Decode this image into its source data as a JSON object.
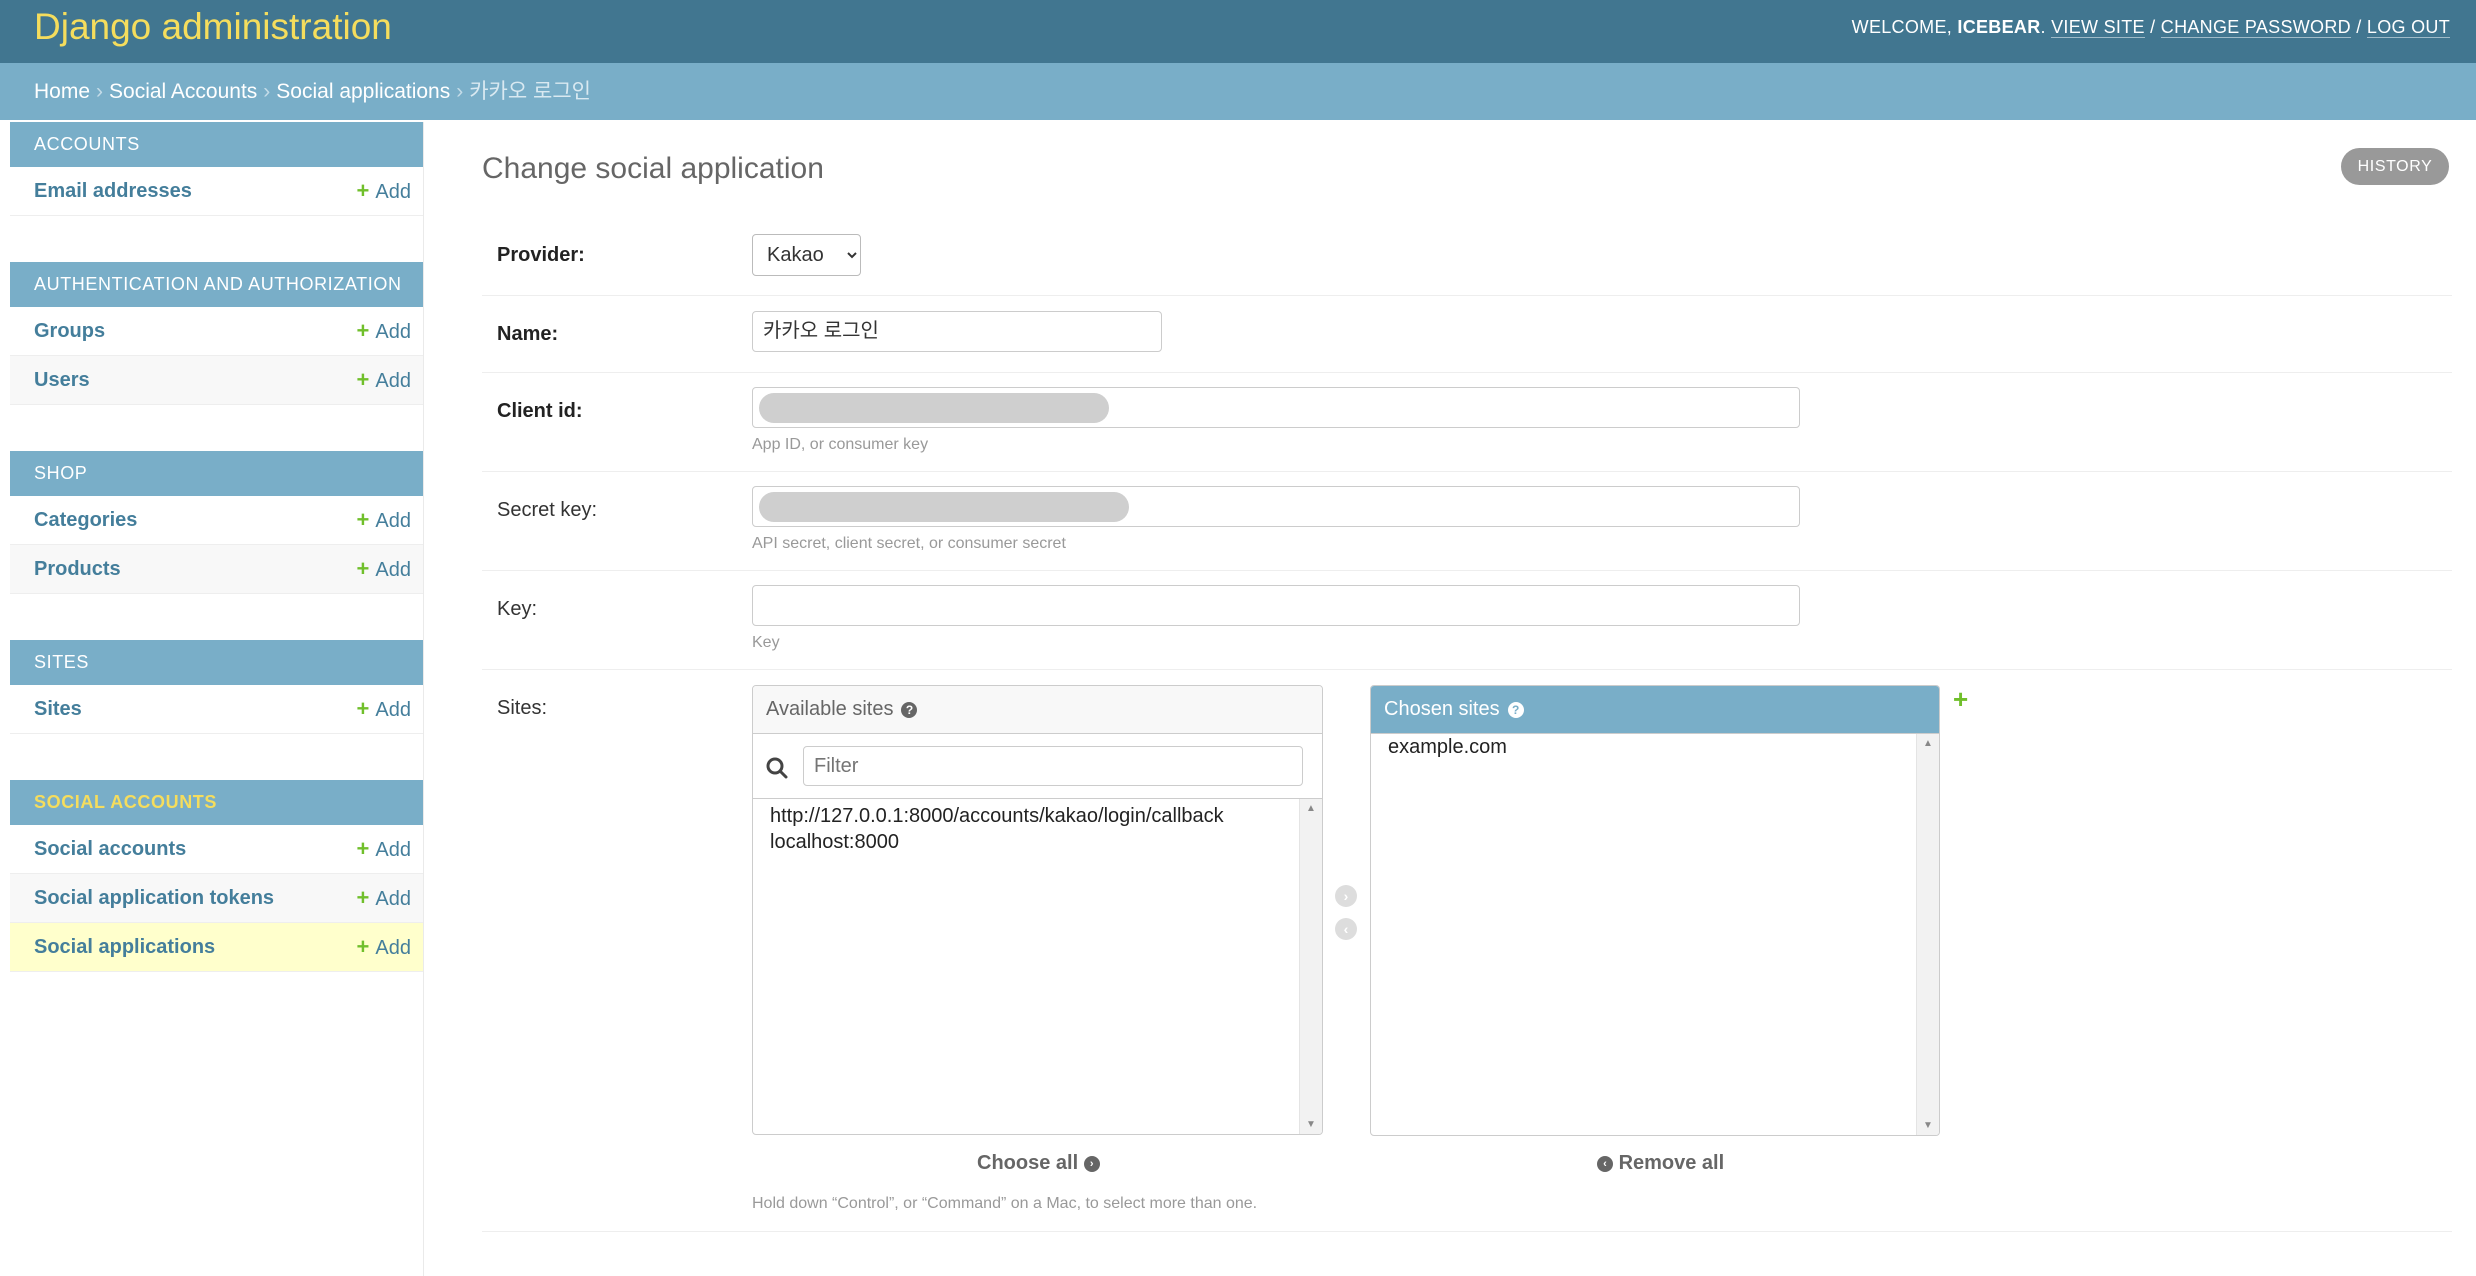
{
  "header": {
    "branding": "Django administration",
    "welcome": "WELCOME,",
    "username": "ICEBEAR",
    "view_site": "VIEW SITE",
    "change_password": "CHANGE PASSWORD",
    "logout": "LOG OUT",
    "sep": "/"
  },
  "breadcrumbs": {
    "home": "Home",
    "app": "Social Accounts",
    "model": "Social applications",
    "current": "카카오 로그인",
    "sep": "›"
  },
  "sidebar": {
    "add_label": "Add",
    "modules": [
      {
        "caption": "ACCOUNTS",
        "items": [
          "Email addresses"
        ]
      },
      {
        "caption": "AUTHENTICATION AND AUTHORIZATION",
        "items": [
          "Groups",
          "Users"
        ]
      },
      {
        "caption": "SHOP",
        "items": [
          "Categories",
          "Products"
        ]
      },
      {
        "caption": "SITES",
        "items": [
          "Sites"
        ]
      },
      {
        "caption": "SOCIAL ACCOUNTS",
        "items": [
          "Social accounts",
          "Social application tokens",
          "Social applications"
        ]
      }
    ]
  },
  "main": {
    "title": "Change social application",
    "history": "HISTORY",
    "provider": {
      "label": "Provider:",
      "value": "Kakao"
    },
    "name": {
      "label": "Name:",
      "value": "카카오 로그인"
    },
    "client_id": {
      "label": "Client id:",
      "help": "App ID, or consumer key"
    },
    "secret_key": {
      "label": "Secret key:",
      "help": "API secret, client secret, or consumer secret"
    },
    "key": {
      "label": "Key:",
      "help": "Key"
    },
    "sites": {
      "label": "Sites:",
      "available_title": "Available sites",
      "filter_placeholder": "Filter",
      "available_options": [
        "http://127.0.0.1:8000/accounts/kakao/login/callback",
        "localhost:8000"
      ],
      "chosen_title": "Chosen sites",
      "chosen_options": [
        "example.com"
      ],
      "choose_all": "Choose all",
      "remove_all": "Remove all",
      "help": "Hold down “Control”, or “Command” on a Mac, to select more than one."
    }
  },
  "colors": {
    "header_bg": "#417690",
    "breadcrumb_bg": "#79aec8",
    "branding": "#f5dd5d",
    "link": "#447e9b",
    "add_plus": "#70bf2b",
    "current_row": "#ffffcc"
  }
}
